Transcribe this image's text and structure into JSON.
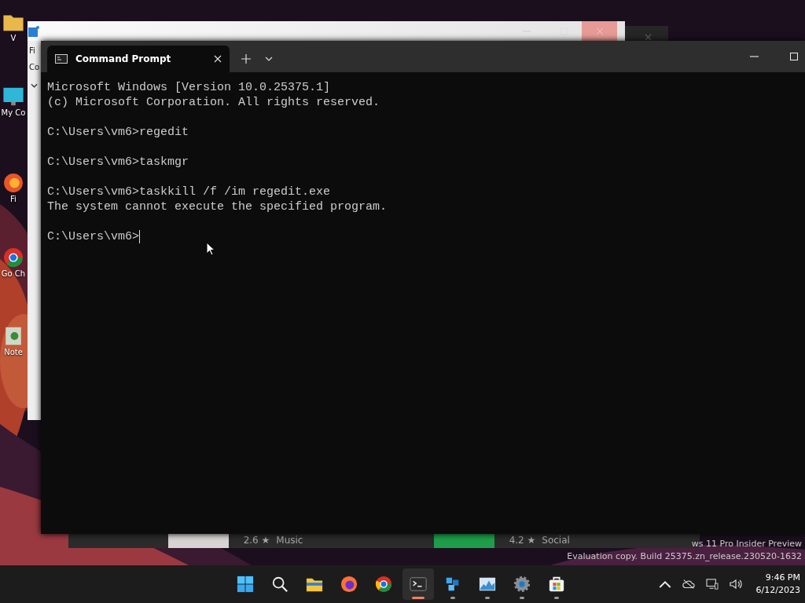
{
  "desktop": {
    "icons": [
      {
        "kind": "folder",
        "label": "V"
      },
      {
        "kind": "monitor",
        "label": "My Co"
      },
      {
        "kind": "firefox",
        "label": "Fi"
      },
      {
        "kind": "chrome",
        "label": "Go Ch"
      },
      {
        "kind": "notepad",
        "label": "Note"
      }
    ]
  },
  "back_window": {
    "menu": [
      "Fi",
      "Co"
    ]
  },
  "store_strip": {
    "items": [
      {
        "rating": "2.6 ★",
        "category": "Music"
      },
      {
        "rating": "4.2 ★",
        "category": "Social"
      }
    ]
  },
  "watermark": [
    "ws 11 Pro Insider Preview",
    "Evaluation copy. Build 25375.zn_release.230520-1632"
  ],
  "terminal": {
    "tab": {
      "title": "Command Prompt",
      "selected": true
    },
    "blocks": [
      [
        "Microsoft Windows [Version 10.0.25375.1]",
        "(c) Microsoft Corporation. All rights reserved."
      ],
      [
        "C:\\Users\\vm6>regedit"
      ],
      [
        "C:\\Users\\vm6>taskmgr"
      ],
      [
        "C:\\Users\\vm6>taskkill /f /im regedit.exe",
        "The system cannot execute the specified program."
      ],
      [
        "C:\\Users\\vm6>"
      ]
    ],
    "cursor": true
  },
  "taskbar": {
    "apps": [
      {
        "kind": "start",
        "open": false,
        "active": false
      },
      {
        "kind": "search",
        "open": false,
        "active": false
      },
      {
        "kind": "folder",
        "open": false,
        "active": false
      },
      {
        "kind": "firefox",
        "open": false,
        "active": false
      },
      {
        "kind": "chrome",
        "open": false,
        "active": false
      },
      {
        "kind": "terminal",
        "open": true,
        "active": true
      },
      {
        "kind": "blocks",
        "open": true,
        "active": false
      },
      {
        "kind": "chart",
        "open": true,
        "active": false
      },
      {
        "kind": "gear",
        "open": true,
        "active": false
      },
      {
        "kind": "store",
        "open": true,
        "active": false
      }
    ],
    "time": "9:46 PM",
    "date": "6/12/2023"
  }
}
